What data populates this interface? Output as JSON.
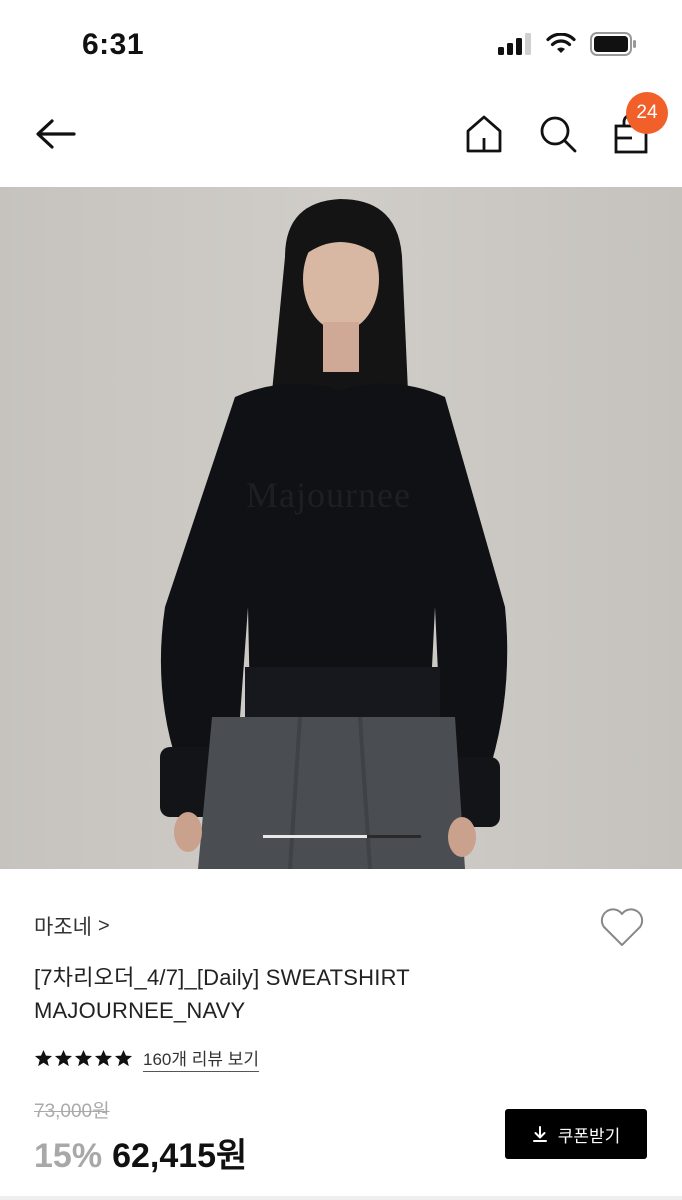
{
  "status_bar": {
    "time": "6:31",
    "icons": [
      "signal-icon",
      "wifi-icon",
      "battery-icon"
    ]
  },
  "nav": {
    "icons": [
      "back-arrow-icon",
      "home-icon",
      "search-icon",
      "shopping-bag-icon"
    ],
    "cart_count": "24",
    "badge_color": "#f2602a"
  },
  "product": {
    "image": {
      "description_icon": "product-photo-placeholder",
      "chest_logo_text": "Majournee"
    },
    "carousel": {
      "current": 1,
      "total": 2
    },
    "brand": "마조네",
    "brand_chevron": ">",
    "title_line1": "[7차리오더_4/7]_[Daily] SWEATSHIRT",
    "title_line2": "MAJOURNEE_NAVY",
    "rating_stars": 5,
    "review_link": "160개 리뷰 보기",
    "original_price": "73,000원",
    "discount": "15%",
    "price": "62,415원",
    "coupon_button": "쿠폰받기"
  },
  "colors": {
    "accent": "#f2602a",
    "button_bg": "#000000",
    "discount_text": "#a8a8a8"
  }
}
